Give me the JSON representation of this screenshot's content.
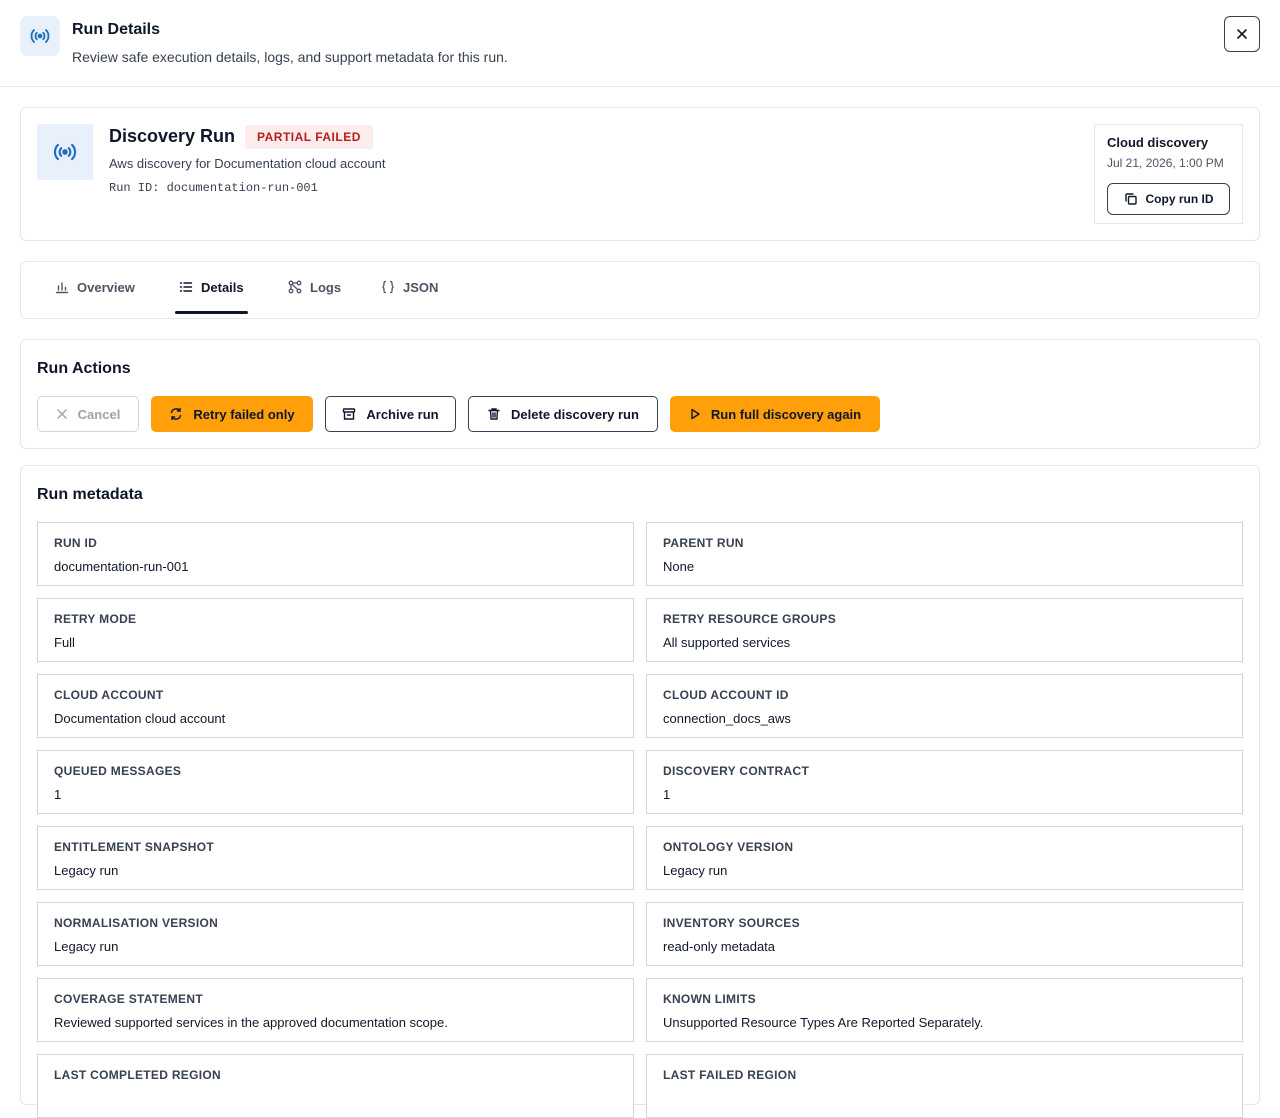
{
  "header": {
    "title": "Run Details",
    "subtitle": "Review safe execution details, logs, and support metadata for this run."
  },
  "summary": {
    "title": "Discovery Run",
    "status": "PARTIAL FAILED",
    "description": "Aws discovery for Documentation cloud account",
    "run_id_text": "Run ID: documentation-run-001",
    "side_title": "Cloud discovery",
    "side_date": "Jul 21, 2026, 1:00 PM",
    "copy_label": "Copy run ID"
  },
  "tabs": [
    {
      "label": "Overview",
      "icon": "bar-chart-icon"
    },
    {
      "label": "Details",
      "icon": "list-icon"
    },
    {
      "label": "Logs",
      "icon": "flow-icon"
    },
    {
      "label": "JSON",
      "icon": "braces-icon"
    }
  ],
  "active_tab": "Details",
  "actions": {
    "title": "Run Actions",
    "cancel": "Cancel",
    "retry_failed": "Retry failed only",
    "archive": "Archive run",
    "delete": "Delete discovery run",
    "run_again": "Run full discovery again"
  },
  "metadata": {
    "title": "Run metadata",
    "items": [
      {
        "label": "RUN ID",
        "value": "documentation-run-001"
      },
      {
        "label": "PARENT RUN",
        "value": "None"
      },
      {
        "label": "RETRY MODE",
        "value": "Full"
      },
      {
        "label": "RETRY RESOURCE GROUPS",
        "value": "All supported services"
      },
      {
        "label": "CLOUD ACCOUNT",
        "value": "Documentation cloud account"
      },
      {
        "label": "CLOUD ACCOUNT ID",
        "value": "connection_docs_aws"
      },
      {
        "label": "QUEUED MESSAGES",
        "value": "1"
      },
      {
        "label": "DISCOVERY CONTRACT",
        "value": "1"
      },
      {
        "label": "ENTITLEMENT SNAPSHOT",
        "value": "Legacy run"
      },
      {
        "label": "ONTOLOGY VERSION",
        "value": "Legacy run"
      },
      {
        "label": "NORMALISATION VERSION",
        "value": "Legacy run"
      },
      {
        "label": "INVENTORY SOURCES",
        "value": "read-only metadata"
      },
      {
        "label": "COVERAGE STATEMENT",
        "value": "Reviewed supported services in the approved documentation scope."
      },
      {
        "label": "KNOWN LIMITS",
        "value": "Unsupported Resource Types Are Reported Separately."
      },
      {
        "label": "LAST COMPLETED REGION",
        "value": ""
      },
      {
        "label": "LAST FAILED REGION",
        "value": ""
      }
    ]
  },
  "colors": {
    "accent": "#ff9f0a",
    "status_bg": "#fdecec",
    "status_text": "#b91c1c",
    "icon_bg": "#e8f1fb",
    "icon_blue": "#1f6fbf"
  }
}
